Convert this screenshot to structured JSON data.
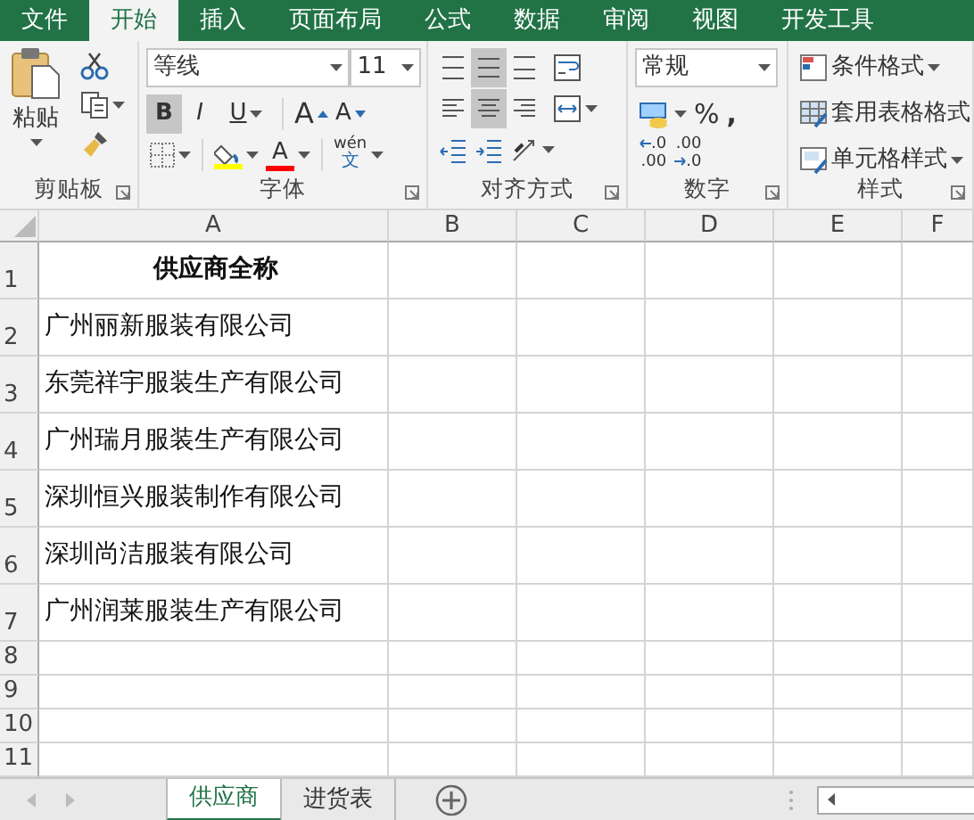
{
  "ribbon_tabs": [
    {
      "label": "文件",
      "selected": false
    },
    {
      "label": "开始",
      "selected": true
    },
    {
      "label": "插入",
      "selected": false
    },
    {
      "label": "页面布局",
      "selected": false
    },
    {
      "label": "公式",
      "selected": false
    },
    {
      "label": "数据",
      "selected": false
    },
    {
      "label": "审阅",
      "selected": false
    },
    {
      "label": "视图",
      "selected": false
    },
    {
      "label": "开发工具",
      "selected": false
    }
  ],
  "clipboard": {
    "paste": "粘贴",
    "label": "剪贴板"
  },
  "font": {
    "name": "等线",
    "size": "11",
    "bold": {
      "text": "B",
      "on": true
    },
    "italic": {
      "text": "I",
      "on": false
    },
    "underline": {
      "text": "U",
      "on": false
    },
    "grow": "A",
    "shrink": "A",
    "font_color": "A",
    "phonetic": "wén",
    "phonetic_char": "文",
    "label": "字体"
  },
  "alignment": {
    "label": "对齐方式",
    "buttons": [
      {
        "kind": "top",
        "on": false
      },
      {
        "kind": "middle",
        "on": true
      },
      {
        "kind": "bottom",
        "on": false
      },
      {
        "kind": "wrap",
        "on": false
      },
      {
        "kind": "left",
        "on": false
      },
      {
        "kind": "center",
        "on": true
      },
      {
        "kind": "right",
        "on": false
      },
      {
        "kind": "merge",
        "on": false
      },
      {
        "kind": "outdent",
        "on": false
      },
      {
        "kind": "indent",
        "on": false
      },
      {
        "kind": "orientation",
        "on": false
      }
    ]
  },
  "number": {
    "format": "常规",
    "percent": "%",
    "comma": ",",
    "increase_decimal": {
      "top": ".0",
      "bottom": ".00"
    },
    "decrease_decimal": {
      "top": ".00",
      "bottom": ".0"
    },
    "label": "数字"
  },
  "styles": {
    "items": [
      "条件格式",
      "套用表格格式",
      "单元格样式"
    ],
    "label": "样式"
  },
  "columns": [
    "A",
    "B",
    "C",
    "D",
    "E",
    "F"
  ],
  "rows": [
    {
      "number": "1",
      "kind": "header",
      "cells": [
        "供应商全称"
      ]
    },
    {
      "number": "2",
      "kind": "data",
      "cells": [
        "广州丽新服装有限公司"
      ]
    },
    {
      "number": "3",
      "kind": "data",
      "cells": [
        "东莞祥宇服装生产有限公司"
      ]
    },
    {
      "number": "4",
      "kind": "data",
      "cells": [
        "广州瑞月服装生产有限公司"
      ]
    },
    {
      "number": "5",
      "kind": "data",
      "cells": [
        "深圳恒兴服装制作有限公司"
      ]
    },
    {
      "number": "6",
      "kind": "data",
      "cells": [
        "深圳尚洁服装有限公司"
      ]
    },
    {
      "number": "7",
      "kind": "data",
      "cells": [
        "广州润莱服装生产有限公司"
      ]
    },
    {
      "number": "8",
      "kind": "empty",
      "cells": []
    },
    {
      "number": "9",
      "kind": "empty",
      "cells": []
    },
    {
      "number": "10",
      "kind": "empty",
      "cells": []
    },
    {
      "number": "11",
      "kind": "empty",
      "cells": []
    }
  ],
  "sheet_tabs": [
    {
      "label": "供应商",
      "selected": true
    },
    {
      "label": "进货表",
      "selected": false
    }
  ]
}
